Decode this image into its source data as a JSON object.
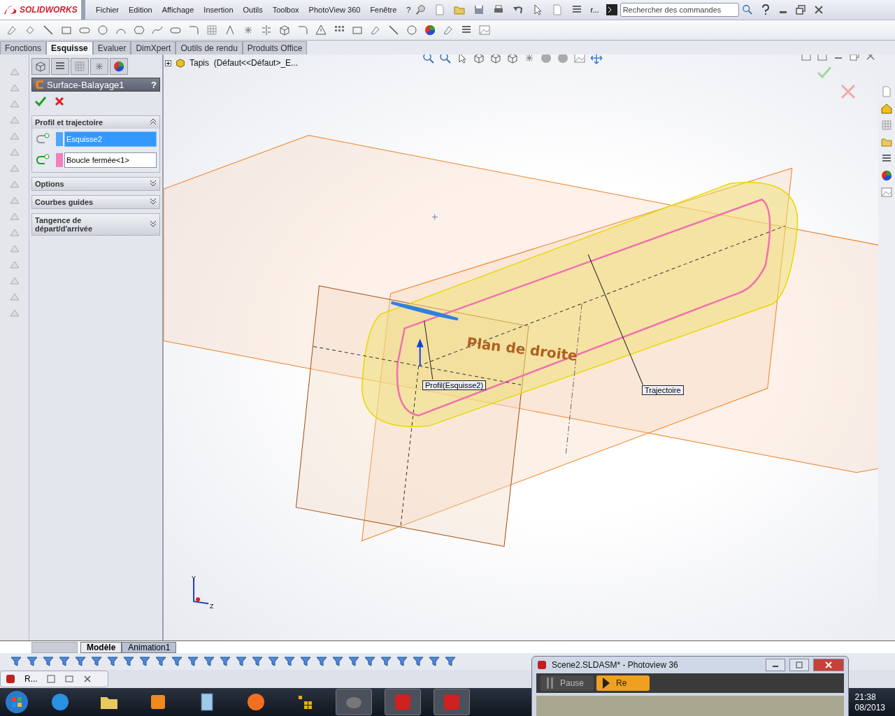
{
  "app": {
    "logo": "SOLIDWORKS",
    "menu": [
      "Fichier",
      "Edition",
      "Affichage",
      "Insertion",
      "Outils",
      "Toolbox",
      "PhotoView 360",
      "Fenêtre",
      "?"
    ],
    "truncated_button": "r...",
    "search": {
      "placeholder": "Rechercher des commandes"
    }
  },
  "command_tabs": [
    {
      "label": "Fonctions",
      "selected": false
    },
    {
      "label": "Esquisse",
      "selected": true
    },
    {
      "label": "Evaluer",
      "selected": false
    },
    {
      "label": "DimXpert",
      "selected": false
    },
    {
      "label": "Outils de rendu",
      "selected": false
    },
    {
      "label": "Produits Office",
      "selected": false
    }
  ],
  "feature_tree": {
    "root": "Tapis  (Défaut<<Défaut>_E..."
  },
  "property_manager": {
    "title": "Surface-Balayage1",
    "help": "?",
    "sections": [
      {
        "title": "Profil et trajectoire",
        "expanded": true,
        "fields": [
          {
            "value": "Esquisse2",
            "color": "#4da6ff",
            "selected": true
          },
          {
            "value": "Boucle fermée<1>",
            "color": "#f080c0",
            "selected": false
          }
        ]
      },
      {
        "title": "Options",
        "expanded": false
      },
      {
        "title": "Courbes guides",
        "expanded": false
      },
      {
        "title": "Tangence de départ/d'arrivée",
        "expanded": false
      }
    ]
  },
  "viewport": {
    "plane_label": "Plan de droite",
    "callouts": [
      {
        "kind": "profile",
        "text": "Profil(Esquisse2)"
      },
      {
        "kind": "path",
        "text": "Trajectoire"
      }
    ],
    "axes": [
      "Y",
      "Z"
    ]
  },
  "model_tabs": [
    {
      "label": "Modèle",
      "selected": true
    },
    {
      "label": "Animation1",
      "selected": false
    }
  ],
  "minimized_window": {
    "title": "R..."
  },
  "photoview": {
    "title": "Scene2.SLDASM* - Photoview 36",
    "buttons": [
      {
        "kind": "pause",
        "label": "Pause",
        "selected": false
      },
      {
        "kind": "play",
        "label": "Re",
        "selected": true
      }
    ]
  },
  "clock": {
    "time": "21:38",
    "date": "08/2013"
  }
}
